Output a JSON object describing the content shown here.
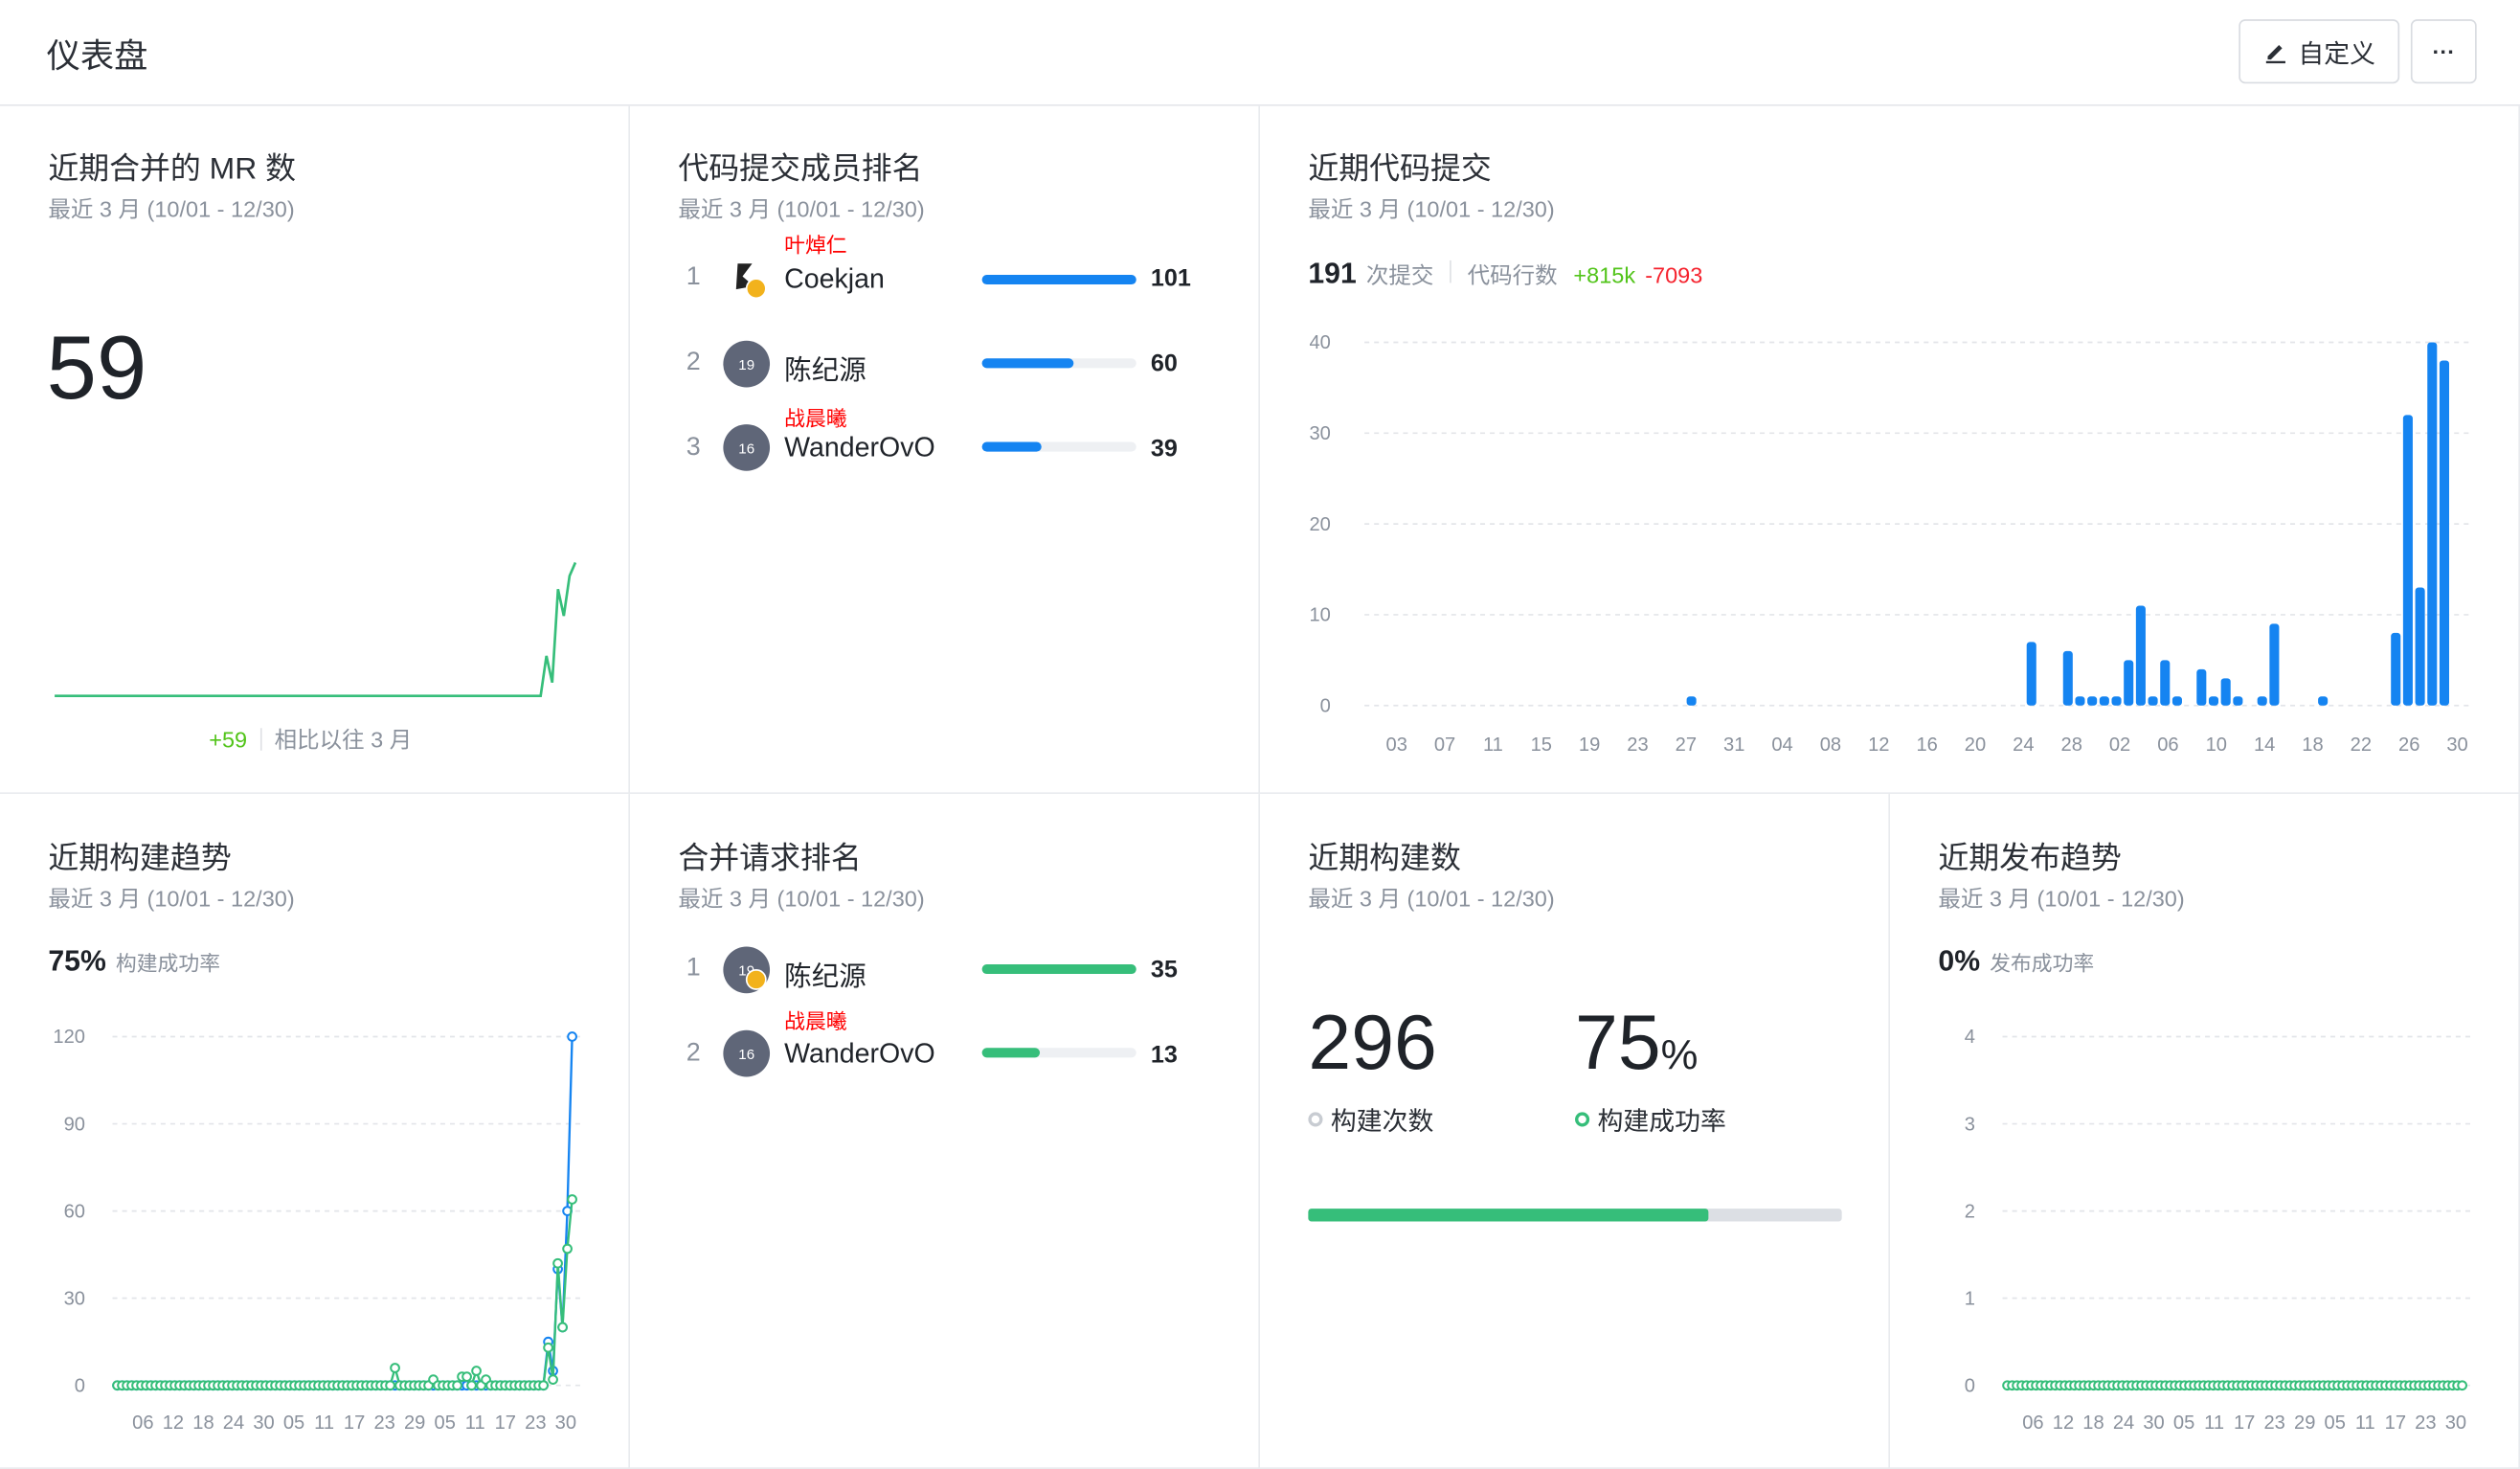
{
  "header": {
    "title": "仪表盘",
    "customize_label": "自定义",
    "more_label": "···"
  },
  "subtitle": "最近 3 月 (10/01 - 12/30)",
  "mr_card": {
    "title": "近期合并的 MR 数",
    "value": "59",
    "delta": "+59",
    "compare": "相比以往 3 月"
  },
  "rank_card": {
    "title": "代码提交成员排名",
    "items": [
      {
        "rank": "1",
        "alias": "叶焯仁",
        "name": "Coekjan",
        "value": "101",
        "fraction": 1.0
      },
      {
        "rank": "2",
        "alias": "",
        "name": "陈纪源",
        "avatar": "19",
        "value": "60",
        "fraction": 0.59
      },
      {
        "rank": "3",
        "alias": "战晨曦",
        "name": "WanderOvO",
        "avatar": "16",
        "value": "39",
        "fraction": 0.39
      }
    ]
  },
  "commit_card": {
    "title": "近期代码提交",
    "count": "191",
    "count_label": "次提交",
    "lines_label": "代码行数",
    "added": "+815k",
    "removed": "-7093"
  },
  "build_trend_card": {
    "title": "近期构建趋势",
    "rate": "75%",
    "rate_label": "构建成功率"
  },
  "merge_rank_card": {
    "title": "合并请求排名",
    "items": [
      {
        "rank": "1",
        "alias": "",
        "name": "陈纪源",
        "avatar": "19",
        "value": "35",
        "fraction": 1.0
      },
      {
        "rank": "2",
        "alias": "战晨曦",
        "name": "WanderOvO",
        "avatar": "16",
        "value": "13",
        "fraction": 0.37
      }
    ]
  },
  "build_count_card": {
    "title": "近期构建数",
    "count": "296",
    "count_label": "构建次数",
    "rate": "75",
    "rate_unit": "%",
    "rate_label": "构建成功率",
    "success_fraction": 0.75
  },
  "release_card": {
    "title": "近期发布趋势",
    "rate": "0%",
    "rate_label": "发布成功率"
  },
  "colors": {
    "blue": "#1584f1",
    "green": "#36be7a",
    "red": "#f5222d",
    "grid": "#e3e5e9"
  },
  "chart_data": [
    {
      "type": "line",
      "title": "近期合并的 MR 数",
      "series": [
        {
          "values": [
            0,
            0,
            0,
            0,
            0,
            0,
            0,
            0,
            0,
            0,
            0,
            0,
            0,
            0,
            0,
            0,
            0,
            0,
            0,
            0,
            0,
            0,
            0,
            0,
            0,
            0,
            0,
            0,
            0,
            0,
            0,
            0,
            0,
            0,
            0,
            0,
            0,
            0,
            0,
            0,
            0,
            0,
            0,
            0,
            0,
            0,
            0,
            0,
            0,
            0,
            0,
            0,
            0,
            0,
            0,
            0,
            0,
            0,
            0,
            0,
            0,
            0,
            0,
            0,
            0,
            0,
            0,
            0,
            0,
            0,
            0,
            0,
            0,
            0,
            0,
            0,
            0,
            0,
            0,
            0,
            0,
            0,
            0,
            0,
            0,
            3,
            1,
            8,
            6,
            9,
            10
          ]
        }
      ],
      "ylim": [
        0,
        10
      ]
    },
    {
      "type": "bar",
      "title": "近期代码提交",
      "categories": [
        "03",
        "07",
        "11",
        "15",
        "19",
        "23",
        "27",
        "31",
        "04",
        "08",
        "12",
        "16",
        "20",
        "24",
        "28",
        "02",
        "06",
        "10",
        "14",
        "18",
        "22",
        "26",
        "30"
      ],
      "x_days": [
        27,
        24,
        27,
        28,
        29,
        30,
        1,
        2,
        3,
        4,
        5,
        6,
        8,
        9,
        10,
        11,
        13,
        14,
        18,
        24,
        25,
        26,
        27,
        28,
        29,
        30
      ],
      "x_months": [
        10,
        11,
        11,
        11,
        11,
        11,
        12,
        12,
        12,
        12,
        12,
        12,
        12,
        12,
        12,
        12,
        12,
        12,
        12,
        12,
        12,
        12,
        12,
        12,
        12,
        12
      ],
      "values": [
        1,
        7,
        6,
        1,
        1,
        1,
        1,
        5,
        11,
        1,
        5,
        1,
        4,
        1,
        3,
        1,
        1,
        9,
        1,
        8,
        32,
        13,
        40,
        38
      ],
      "ylim": [
        0,
        40
      ],
      "yticks": [
        0,
        10,
        20,
        30,
        40
      ]
    },
    {
      "type": "line",
      "title": "近期构建趋势",
      "categories": [
        "06",
        "12",
        "18",
        "24",
        "30",
        "05",
        "11",
        "17",
        "23",
        "29",
        "05",
        "11",
        "17",
        "23",
        "30"
      ],
      "series": [
        {
          "color": "#1584f1",
          "values": [
            0,
            0,
            0,
            0,
            0,
            0,
            0,
            0,
            0,
            0,
            0,
            0,
            0,
            0,
            0,
            0,
            0,
            0,
            0,
            0,
            0,
            0,
            0,
            0,
            0,
            0,
            0,
            0,
            0,
            0,
            0,
            0,
            0,
            0,
            0,
            0,
            0,
            0,
            0,
            0,
            0,
            0,
            0,
            0,
            0,
            0,
            0,
            0,
            0,
            0,
            0,
            0,
            0,
            0,
            0,
            0,
            0,
            0,
            0,
            0,
            0,
            0,
            0,
            0,
            0,
            0,
            0,
            0,
            0,
            0,
            0,
            0,
            0,
            0,
            0,
            0,
            0,
            0,
            0,
            0,
            0,
            0,
            0,
            0,
            0,
            0,
            0,
            0,
            0,
            0,
            15,
            5,
            40,
            20,
            60,
            120
          ]
        },
        {
          "color": "#36be7a",
          "values": [
            0,
            0,
            0,
            0,
            0,
            0,
            0,
            0,
            0,
            0,
            0,
            0,
            0,
            0,
            0,
            0,
            0,
            0,
            0,
            0,
            0,
            0,
            0,
            0,
            0,
            0,
            0,
            0,
            0,
            0,
            0,
            0,
            0,
            0,
            0,
            0,
            0,
            0,
            0,
            0,
            0,
            0,
            0,
            0,
            0,
            0,
            0,
            0,
            0,
            0,
            0,
            0,
            0,
            0,
            0,
            0,
            0,
            0,
            6,
            0,
            0,
            0,
            0,
            0,
            0,
            0,
            2,
            0,
            0,
            0,
            0,
            0,
            3,
            3,
            0,
            5,
            0,
            2,
            0,
            0,
            0,
            0,
            0,
            0,
            0,
            0,
            0,
            0,
            0,
            0,
            13,
            2,
            42,
            20,
            47,
            64
          ]
        }
      ],
      "ylim": [
        0,
        120
      ],
      "yticks": [
        0,
        30,
        60,
        90,
        120
      ]
    },
    {
      "type": "line",
      "title": "近期发布趋势",
      "categories": [
        "06",
        "12",
        "18",
        "24",
        "30",
        "05",
        "11",
        "17",
        "23",
        "29",
        "05",
        "11",
        "17",
        "23",
        "30"
      ],
      "series": [
        {
          "color": "#36be7a",
          "values": [
            0,
            0,
            0,
            0,
            0,
            0,
            0,
            0,
            0,
            0,
            0,
            0,
            0,
            0,
            0,
            0,
            0,
            0,
            0,
            0,
            0,
            0,
            0,
            0,
            0,
            0,
            0,
            0,
            0,
            0,
            0,
            0,
            0,
            0,
            0,
            0,
            0,
            0,
            0,
            0,
            0,
            0,
            0,
            0,
            0,
            0,
            0,
            0,
            0,
            0,
            0,
            0,
            0,
            0,
            0,
            0,
            0,
            0,
            0,
            0,
            0,
            0,
            0,
            0,
            0,
            0,
            0,
            0,
            0,
            0,
            0,
            0,
            0,
            0,
            0,
            0,
            0,
            0,
            0,
            0,
            0,
            0,
            0,
            0,
            0,
            0,
            0,
            0,
            0,
            0,
            0,
            0,
            0,
            0,
            0,
            0
          ]
        }
      ],
      "ylim": [
        0,
        4
      ],
      "yticks": [
        0,
        1,
        2,
        3,
        4
      ]
    }
  ]
}
